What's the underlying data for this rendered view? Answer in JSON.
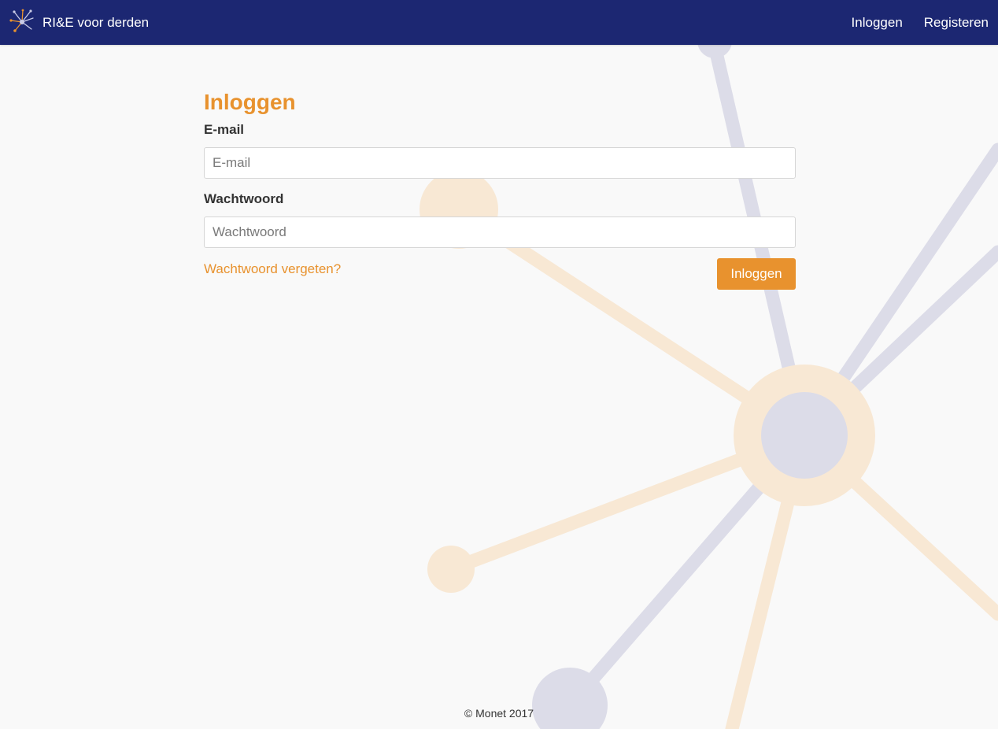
{
  "brand": {
    "name": "RI&E voor derden",
    "icon": "network-logo-icon"
  },
  "nav": {
    "login_label": "Inloggen",
    "register_label": "Registeren"
  },
  "form": {
    "title": "Inloggen",
    "email": {
      "label": "E-mail",
      "placeholder": "E-mail",
      "value": ""
    },
    "password": {
      "label": "Wachtwoord",
      "placeholder": "Wachtwoord",
      "value": ""
    },
    "forgot_label": "Wachtwoord vergeten?",
    "submit_label": "Inloggen"
  },
  "footer": {
    "text": "© Monet 2017"
  },
  "colors": {
    "navbar": "#1c2772",
    "accent": "#e8922e",
    "background": "#f9f9f9",
    "decor_lavender": "#dcdce8",
    "decor_peach": "#f8e8d4"
  }
}
